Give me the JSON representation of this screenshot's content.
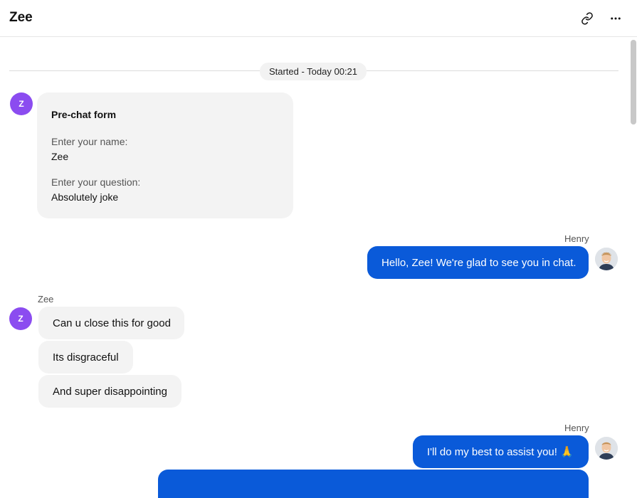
{
  "header": {
    "title": "Zee",
    "link_icon": "link-icon",
    "more_icon": "more-horizontal-icon"
  },
  "chat": {
    "started_label": "Started - Today 00:21",
    "customer_initial": "Z",
    "prechat_form": {
      "title": "Pre-chat form",
      "fields": [
        {
          "label": "Enter your name:",
          "value": "Zee"
        },
        {
          "label": "Enter your question:",
          "value": "Absolutely joke"
        }
      ]
    },
    "messages": [
      {
        "sender": "Henry",
        "direction": "out",
        "texts": [
          "Hello, Zee! We're glad to see you in chat."
        ]
      },
      {
        "sender": "Zee",
        "direction": "in",
        "texts": [
          "Can u close this for good",
          "Its disgraceful",
          "And super disappointing"
        ]
      },
      {
        "sender": "Henry",
        "direction": "out",
        "texts": [
          "I'll do my best to assist you! 🙏"
        ]
      }
    ]
  },
  "colors": {
    "accent": "#0a5ad9",
    "customer_avatar": "#8b4cf0",
    "bubble_in": "#f3f3f3"
  }
}
